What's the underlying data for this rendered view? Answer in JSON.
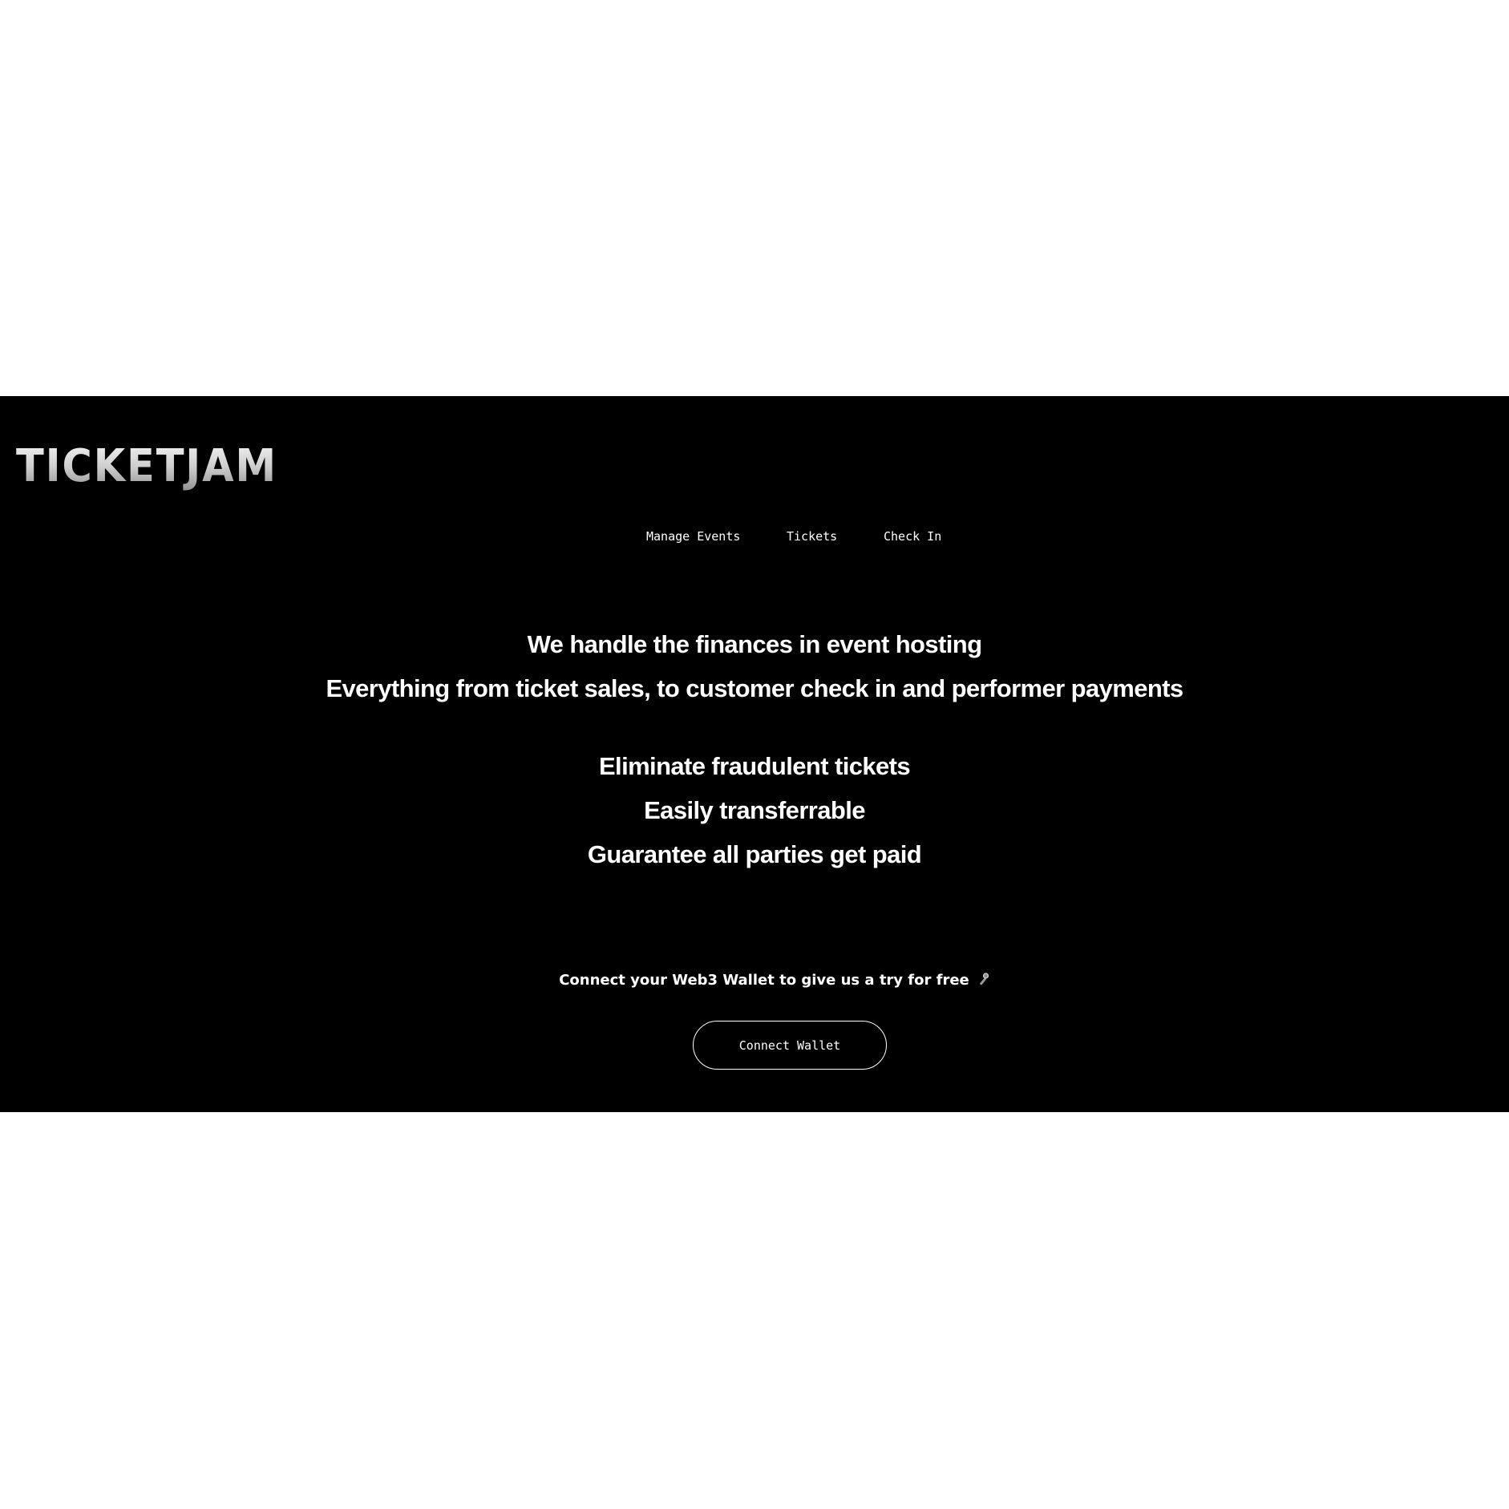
{
  "brand": {
    "logo_text": "TICKETJAM"
  },
  "nav": {
    "items": [
      {
        "label": "Manage Events"
      },
      {
        "label": "Tickets"
      },
      {
        "label": "Check In"
      }
    ]
  },
  "hero": {
    "headline": "We handle the finances in event hosting",
    "subheadline": "Everything from ticket sales, to customer check in and performer payments",
    "features": [
      "Eliminate fraudulent tickets",
      "Easily transferrable",
      "Guarantee all parties get paid"
    ]
  },
  "cta": {
    "text": "Connect your Web3 Wallet to give us a try for free",
    "emoji_icon": "microphone-icon",
    "button_label": "Connect Wallet"
  },
  "colors": {
    "page_background": "#ffffff",
    "app_background": "#000000",
    "text": "#ffffff"
  }
}
